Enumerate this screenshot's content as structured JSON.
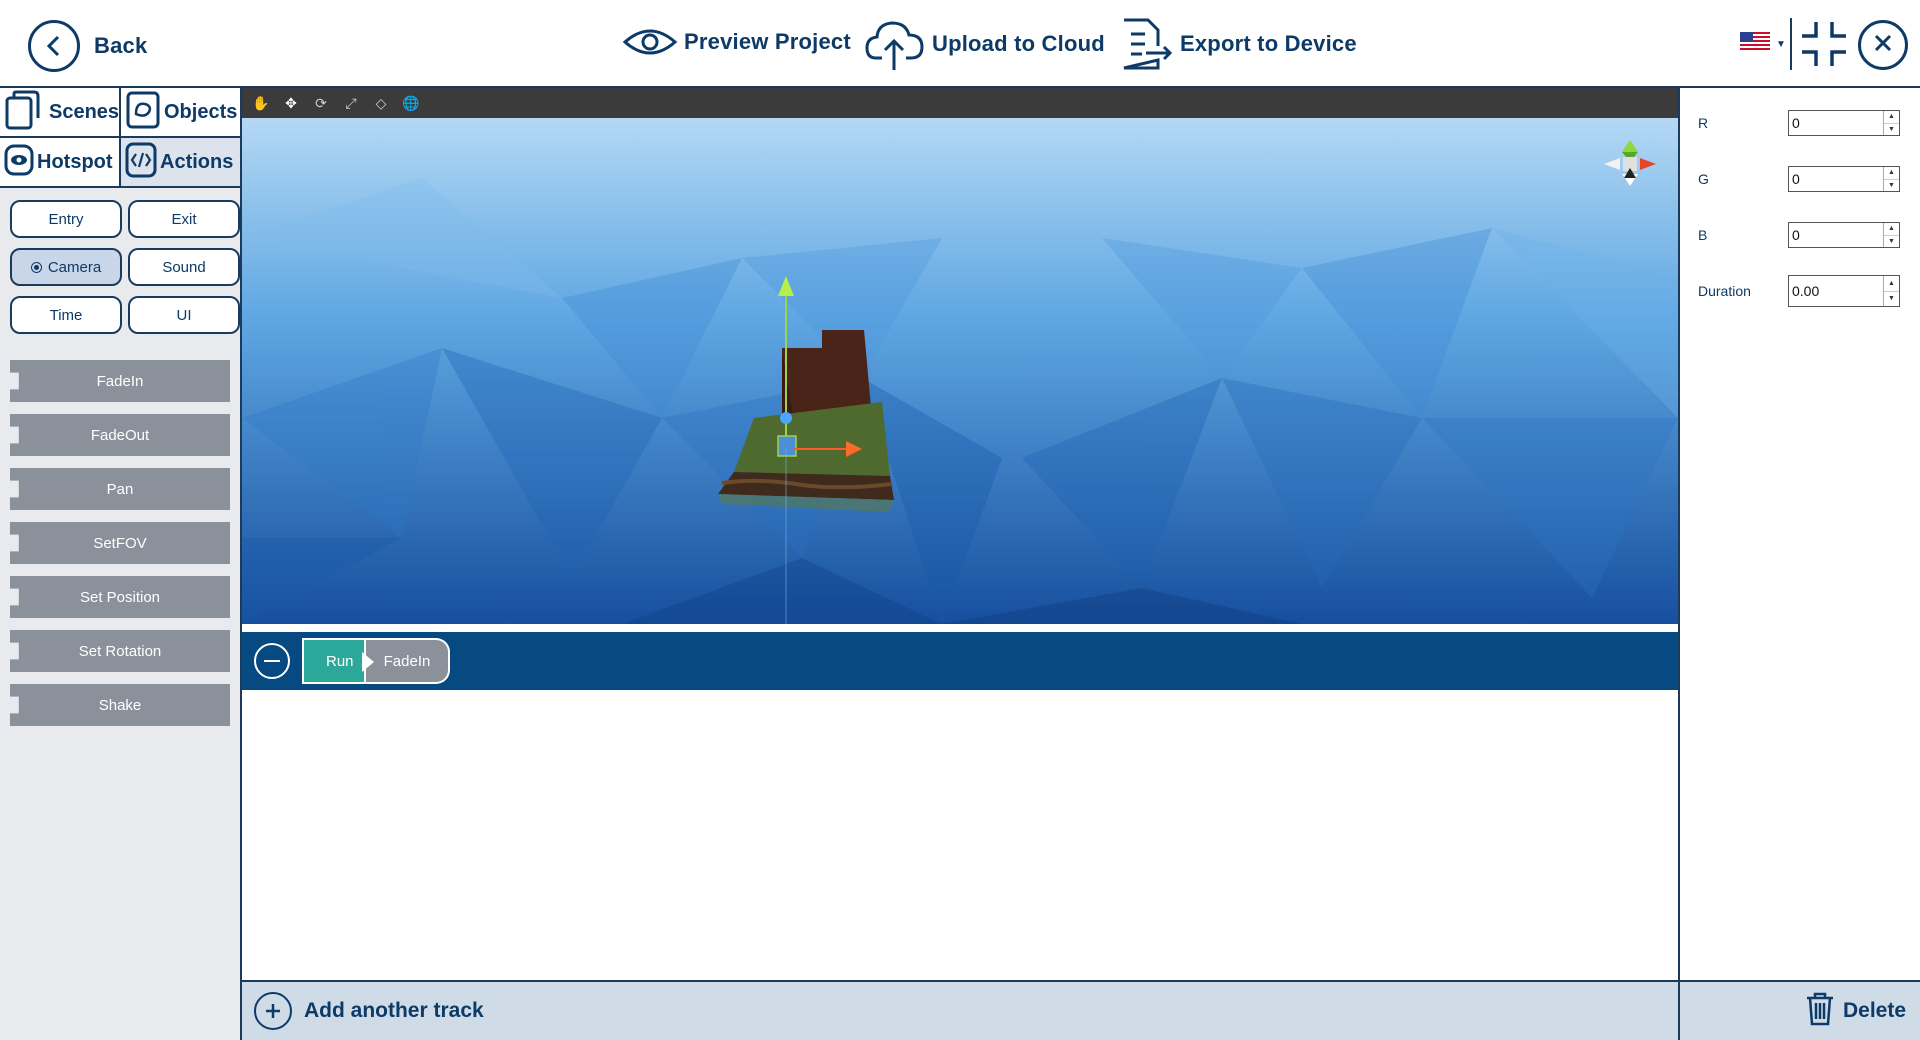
{
  "colors": {
    "brand": "#0d3a66",
    "track_bg": "#074a82",
    "run_block": "#2ca89a",
    "action_block": "#8a919b",
    "footer_bg": "#cfdce8"
  },
  "topbar": {
    "back_label": "Back",
    "preview_label": "Preview Project",
    "upload_label": "Upload to Cloud",
    "export_label": "Export to Device",
    "language_icon": "us-flag-icon"
  },
  "sidebar": {
    "categories": [
      {
        "label": "Scenes",
        "icon": "scenes-icon"
      },
      {
        "label": "Objects",
        "icon": "objects-icon"
      },
      {
        "label": "Hotspot",
        "icon": "eye-icon"
      },
      {
        "label": "Actions",
        "icon": "code-icon"
      }
    ],
    "action_types": [
      "Entry",
      "Exit",
      "Camera",
      "Sound",
      "Time",
      "UI"
    ],
    "selected_type": "Camera",
    "actions": [
      "FadeIn",
      "FadeOut",
      "Pan",
      "SetFOV",
      "Set Position",
      "Set Rotation",
      "Shake"
    ]
  },
  "timeline": {
    "run_label": "Run",
    "blocks": [
      "FadeIn"
    ],
    "add_track_label": "Add another track"
  },
  "properties": {
    "fields": [
      {
        "label": "R",
        "value": "0"
      },
      {
        "label": "G",
        "value": "0"
      },
      {
        "label": "B",
        "value": "0"
      },
      {
        "label": "Duration",
        "value": "0.00"
      }
    ],
    "delete_label": "Delete"
  }
}
